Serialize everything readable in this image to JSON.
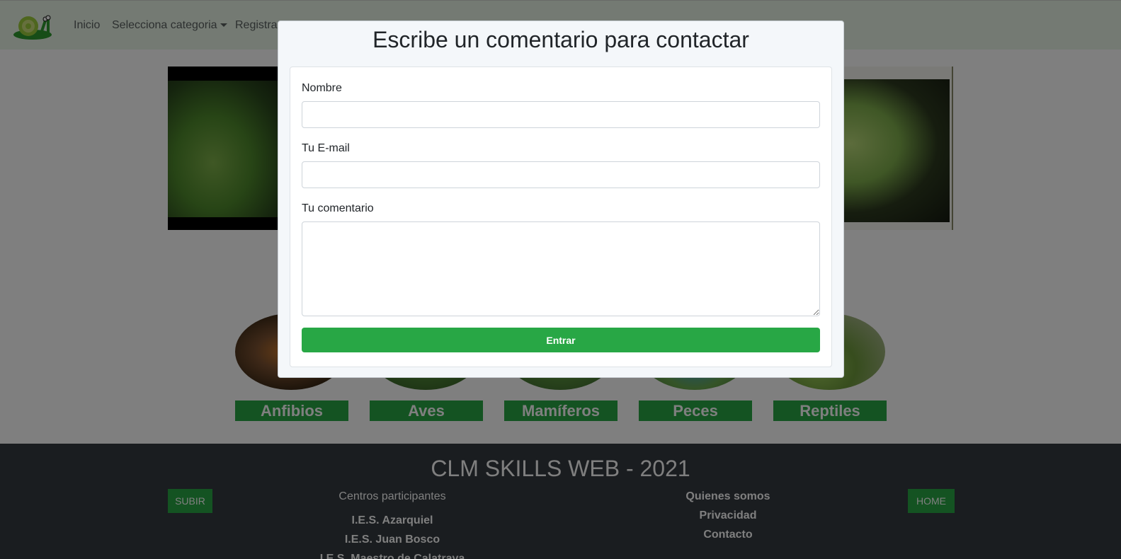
{
  "navbar": {
    "logo_icon": "snail-logo-icon",
    "links": {
      "home": "Inicio",
      "category": "Selecciona categoria",
      "register": "Registrar"
    }
  },
  "categories": [
    {
      "label": "Anfibios"
    },
    {
      "label": "Aves"
    },
    {
      "label": "Mamíferos"
    },
    {
      "label": "Peces"
    },
    {
      "label": "Reptiles"
    }
  ],
  "footer": {
    "title": "CLM SKILLS WEB - 2021",
    "up_button": "SUBIR",
    "home_button": "HOME",
    "centers_heading": "Centros participantes",
    "centers": [
      "I.E.S. Azarquiel",
      "I.E.S. Juan Bosco",
      "I.E.S. Maestro de Calatrava"
    ],
    "links": [
      "Quienes somos",
      "Privacidad",
      "Contacto"
    ]
  },
  "modal": {
    "title": "Escribe un comentario para contactar",
    "name_label": "Nombre",
    "name_value": "",
    "email_label": "Tu E-mail",
    "email_value": "",
    "comment_label": "Tu comentario",
    "comment_value": "",
    "submit_label": "Entrar"
  },
  "colors": {
    "accent": "#28a745",
    "navbar_bg": "#e9f5e7",
    "footer_bg": "#343a40"
  }
}
